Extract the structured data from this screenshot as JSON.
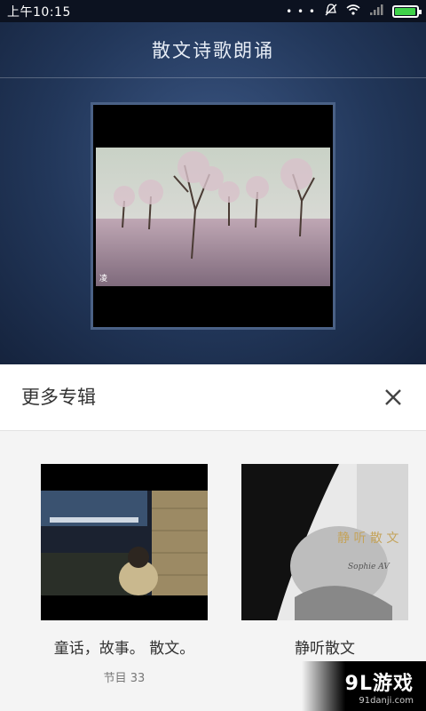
{
  "status_bar": {
    "time": "上午10:15",
    "signal_dots": "• • •",
    "icons": [
      "mute-icon",
      "wifi-icon",
      "signal-icon",
      "battery-icon"
    ],
    "battery_level": 0.95
  },
  "player": {
    "title": "散文诗歌朗诵",
    "cover_caption": "凌"
  },
  "more_albums": {
    "title": "更多专辑",
    "close_icon": "close-icon",
    "albums": [
      {
        "name": "童话，故事。 散文。",
        "count": "节目 33"
      },
      {
        "name": "静听散文",
        "cover_text": "静 听 散 文",
        "cover_signature": "Sophie AV"
      }
    ]
  },
  "watermark": {
    "logo": "9L游戏",
    "url": "91danji.com"
  },
  "colors": {
    "player_bg": "#22375a",
    "sheet_bg": "#f4f4f4",
    "battery": "#3fd24a"
  }
}
